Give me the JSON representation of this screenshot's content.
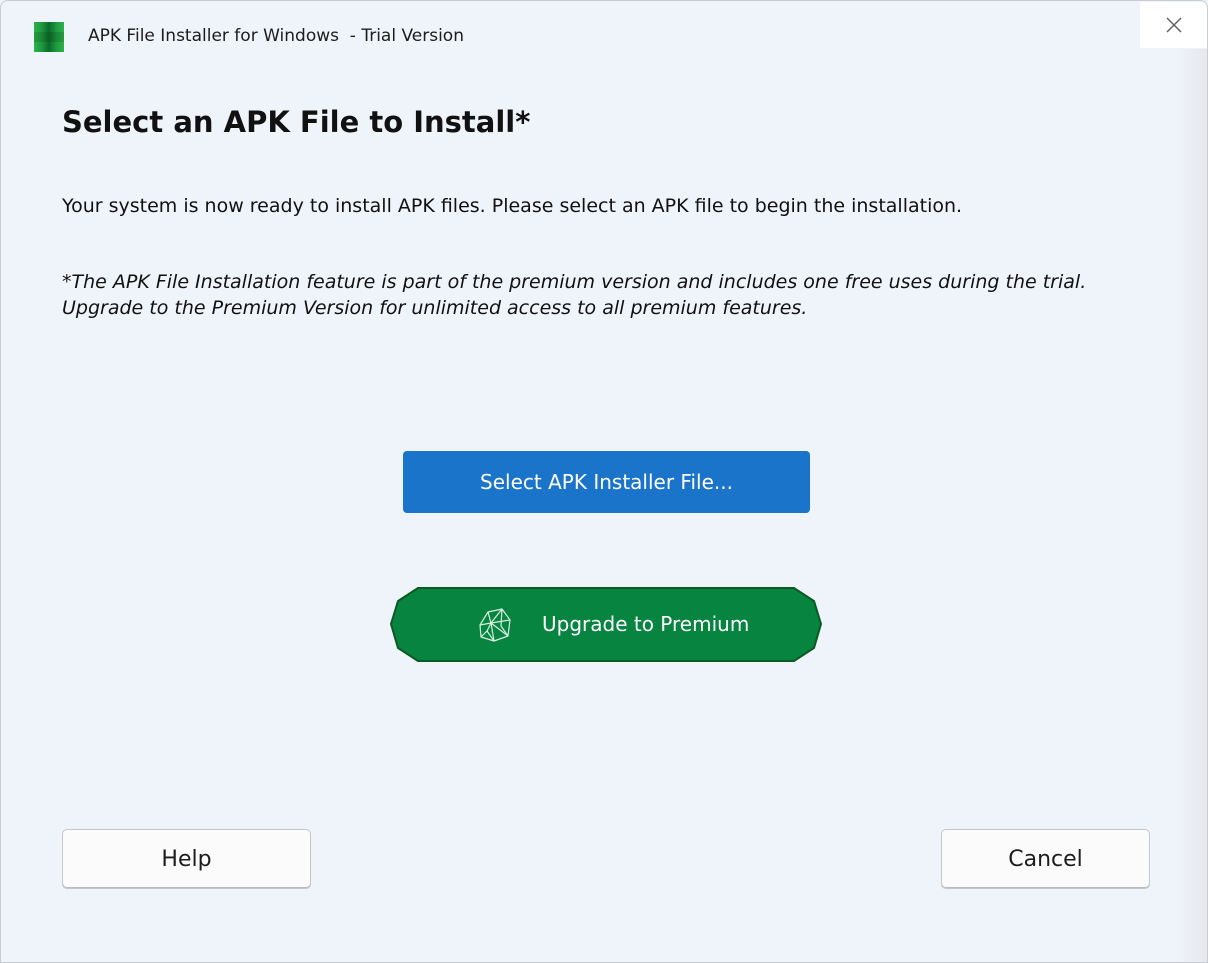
{
  "window": {
    "title": "APK File Installer for Windows  - Trial Version",
    "app_icon": "apk-installer-green-icon",
    "close_icon": "close-icon"
  },
  "main": {
    "heading": "Select an APK File to Install*",
    "info_text": "Your system is now ready to install APK files. Please select an APK file to begin the installation.",
    "note_text": "*The APK File Installation feature is part of the premium version and includes one free uses during the trial. Upgrade to the Premium Version for unlimited access to all premium features."
  },
  "actions": {
    "select_label": "Select APK Installer File...",
    "upgrade_label": "Upgrade to Premium",
    "upgrade_icon": "gem-icon"
  },
  "footer": {
    "help_label": "Help",
    "cancel_label": "Cancel"
  },
  "colors": {
    "background": "#eff3fa",
    "primary_button": "#1a74c9",
    "premium_button": "#07843f",
    "premium_border": "#0b5a23"
  }
}
